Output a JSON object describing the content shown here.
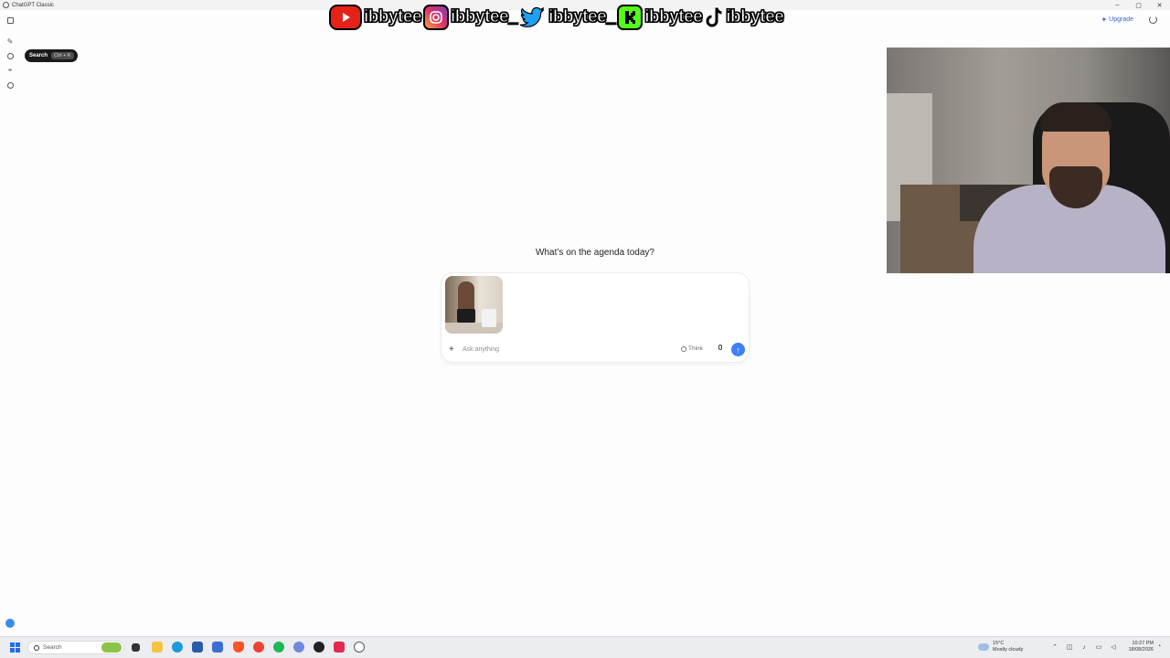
{
  "window": {
    "title": "ChatGPT Classic",
    "controls": [
      "–",
      "▢",
      "✕"
    ]
  },
  "stream_overlay": {
    "socials": [
      {
        "platform_icon": "youtube-icon",
        "handle": "ibbytee"
      },
      {
        "platform_icon": "instagram-icon",
        "handle": "ibbytee_"
      },
      {
        "platform_icon": "twitter-icon",
        "handle": "ibbytee_"
      },
      {
        "platform_icon": "kick-icon",
        "handle": "ibbytee"
      },
      {
        "platform_icon": "tiktok-icon",
        "handle": "ibbytee"
      }
    ]
  },
  "header": {
    "upgrade_label": "Upgrade"
  },
  "sidebar": {
    "icons": [
      "toggle-sidebar-icon",
      "new-chat-icon",
      "search-icon",
      "pin-icon",
      "chat-bubble-icon"
    ],
    "tooltip": {
      "label": "Search",
      "shortcut": "Ctrl + K"
    }
  },
  "main": {
    "heading": "What’s on the agenda today?",
    "composer": {
      "placeholder": "Ask anything",
      "think_label": "Think",
      "attachment": "image-thumbnail"
    }
  },
  "taskbar": {
    "search_label": "Search",
    "weather_temp": "15°C",
    "weather_desc": "Mostly cloudy",
    "time": "10:27 PM",
    "date": "18/08/2026"
  },
  "colors": {
    "accent": "#3b82f6",
    "upgrade": "#3a66d9",
    "kick": "#53fc18",
    "youtube": "#e62117"
  }
}
